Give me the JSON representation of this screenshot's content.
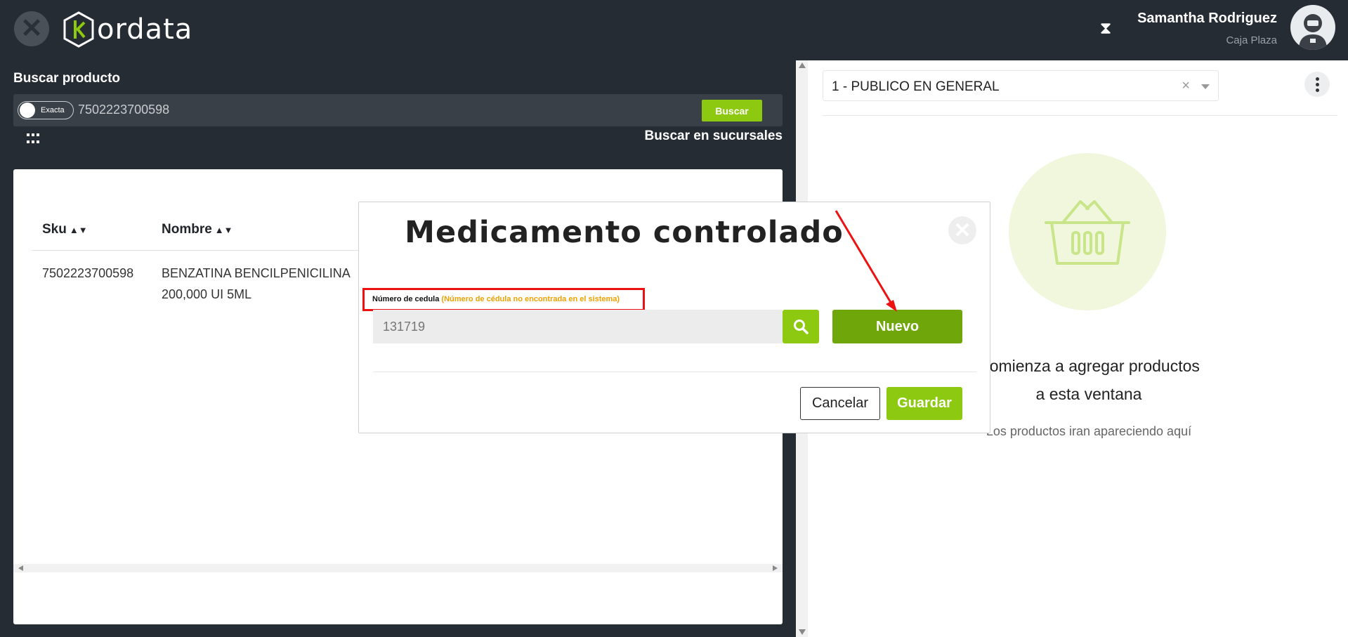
{
  "header": {
    "logo_text": "ordata",
    "user_name": "Samantha Rodriguez",
    "user_location": "Caja Plaza",
    "icons": {
      "close": "close-icon",
      "timer": "hourglass-icon",
      "avatar": "avatar-icon"
    }
  },
  "search": {
    "label": "Buscar producto",
    "toggle_label": "Exacta",
    "value": "7502223700598",
    "button_label": "Buscar",
    "branches_link": "Buscar en sucursales"
  },
  "table": {
    "columns": [
      "Sku",
      "Nombre"
    ],
    "rows": [
      {
        "sku": "7502223700598",
        "name_line1": "BENZATINA BENCILPENICILINA",
        "name_line2": "200,000 UI 5ML"
      }
    ]
  },
  "client": {
    "selected": "1 - PUBLICO EN GENERAL"
  },
  "cart": {
    "empty_line1": "Comienza a agregar productos",
    "empty_line2": "a esta ventana",
    "empty_sub": "Los productos iran apareciendo aquí"
  },
  "modal": {
    "title": "Medicamento controlado",
    "field_label": "Número de cedula",
    "field_warning": "(Número de cédula no encontrada en el sistema)",
    "field_placeholder": "131719",
    "new_button": "Nuevo",
    "cancel_button": "Cancelar",
    "save_button": "Guardar"
  },
  "colors": {
    "brand_green": "#8cc910",
    "dark_green": "#6fa70a",
    "warning_orange": "#f0a000",
    "annotation_red": "#ee1111",
    "dark_bg": "#262c33"
  }
}
